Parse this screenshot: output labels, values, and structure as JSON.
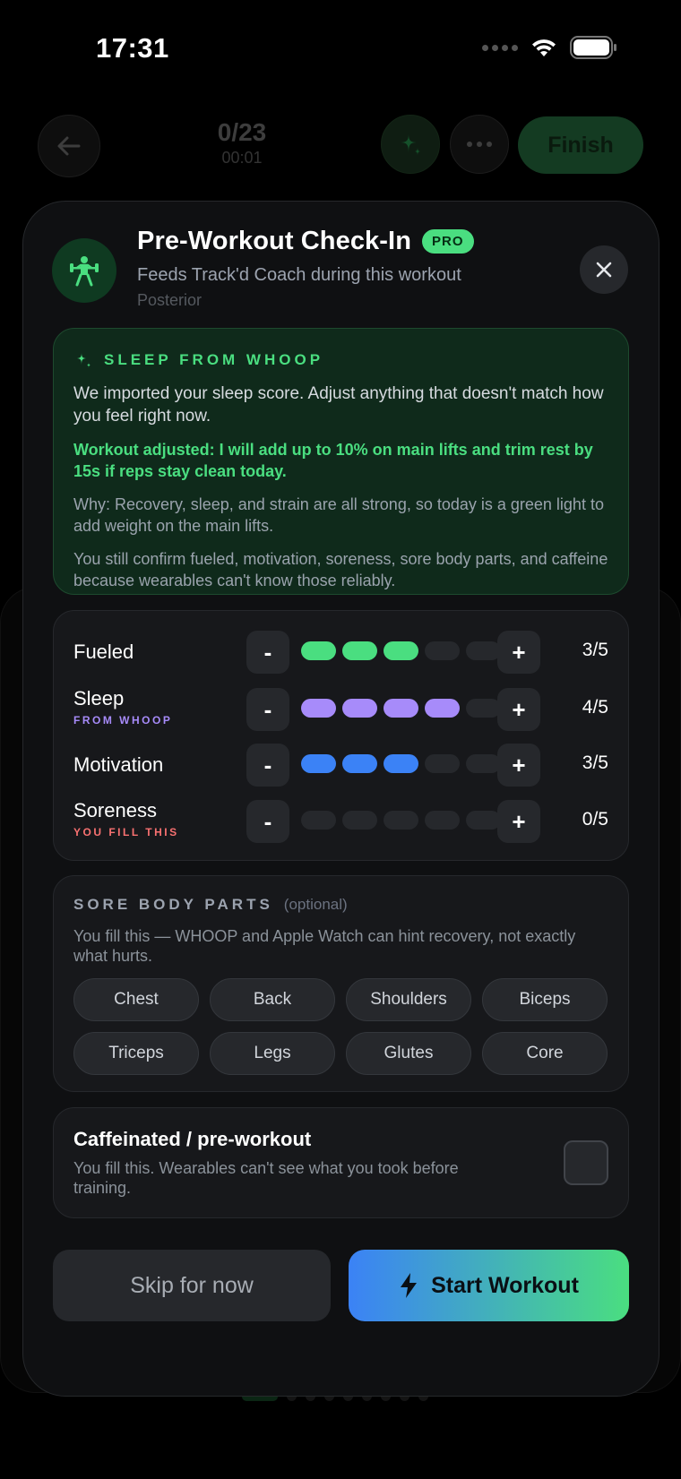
{
  "status_bar": {
    "time": "17:31"
  },
  "nav": {
    "counter": "0/23",
    "timer": "00:01",
    "finish_label": "Finish"
  },
  "modal": {
    "title": "Pre-Workout Check-In",
    "badge": "PRO",
    "subtitle": "Feeds Track'd Coach during this workout",
    "workout_name": "Posterior",
    "whoop": {
      "label": "SLEEP FROM WHOOP",
      "intro": "We imported your sleep score. Adjust anything that doesn't match how you feel right now.",
      "adjusted": "Workout adjusted: I will add up to 10% on main lifts and trim rest by 15s if reps stay clean today.",
      "why": "Why: Recovery, sleep, and strain are all strong, so today is a green light to add weight on the main lifts.",
      "note": "You still confirm fueled, motivation, soreness, sore body parts, and caffeine because wearables can't know those reliably."
    },
    "ratings": [
      {
        "label": "Fueled",
        "sub": "",
        "value": 3,
        "max": 5,
        "display": "3/5",
        "color": "#4ade80"
      },
      {
        "label": "Sleep",
        "sub": "FROM WHOOP",
        "sub_color": "#a78bfa",
        "value": 4,
        "max": 5,
        "display": "4/5",
        "color": "#a78bfa"
      },
      {
        "label": "Motivation",
        "sub": "",
        "value": 3,
        "max": 5,
        "display": "3/5",
        "color": "#3b82f6"
      },
      {
        "label": "Soreness",
        "sub": "YOU FILL THIS",
        "sub_color": "#f87171",
        "value": 0,
        "max": 5,
        "display": "0/5",
        "color": "#f87171"
      }
    ],
    "stepper": {
      "minus": "-",
      "plus": "+"
    },
    "sore": {
      "title": "SORE BODY PARTS",
      "optional": "(optional)",
      "description": "You fill this — WHOOP and Apple Watch can hint recovery, not exactly what hurts.",
      "parts": [
        "Chest",
        "Back",
        "Shoulders",
        "Biceps",
        "Triceps",
        "Legs",
        "Glutes",
        "Core"
      ]
    },
    "caffeine": {
      "title": "Caffeinated / pre-workout",
      "description": "You fill this. Wearables can't see what you took before training.",
      "checked": false
    },
    "buttons": {
      "skip": "Skip for now",
      "start": "Start Workout"
    }
  }
}
